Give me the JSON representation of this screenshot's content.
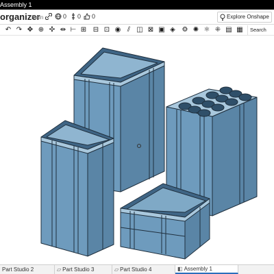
{
  "window": {
    "title": "Assembly 1"
  },
  "header": {
    "document_name": "organizer",
    "workspace": "Main",
    "link_icon": "link-icon",
    "globe_count": "0",
    "version_count": "0",
    "like_count": "0",
    "explore_label": "Explore Onshape"
  },
  "toolbar": {
    "icons": [
      "undo-icon",
      "redo-icon",
      "insert-icon",
      "mate-icon",
      "fastened-icon",
      "revolute-icon",
      "slider-icon",
      "cylindrical-icon",
      "pin-slot-icon",
      "planar-icon",
      "ball-icon",
      "parallel-icon",
      "tangent-icon",
      "mate-connector-icon",
      "group-icon",
      "relation-icon",
      "gear-icon",
      "rack-icon",
      "screw-icon",
      "linear-pattern-icon",
      "circular-pattern-icon",
      "replicate-icon",
      "explode-icon"
    ],
    "search_label": "Search tools"
  },
  "tabs": [
    {
      "label": "Part Studio 2",
      "active": false
    },
    {
      "label": "Part Studio 3",
      "active": false
    },
    {
      "label": "Part Studio 4",
      "active": false
    },
    {
      "label": "Assembly 1",
      "active": true
    }
  ],
  "colors": {
    "part_front": "#6e9bbd",
    "part_side": "#5a85a6",
    "part_top": "#a9c8dd",
    "part_edge": "#1f2f3d",
    "active_tab": "#2a6ebb"
  }
}
